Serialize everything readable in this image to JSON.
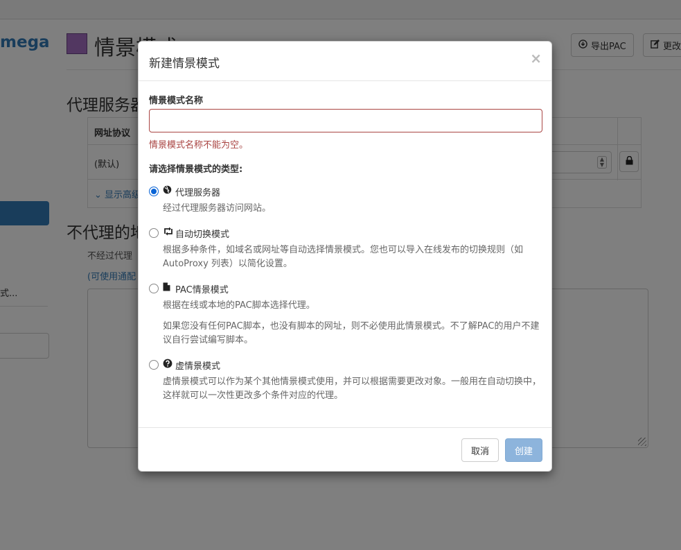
{
  "app": {
    "brand": "mega",
    "profile_title": "情景模式：",
    "export_pac_label": "导出PAC",
    "change_label": "更改"
  },
  "proxy_section": {
    "title": "代理服务器",
    "col_protocol": "网址协议",
    "default_row": "(默认)",
    "show_advanced": "显示高级"
  },
  "bypass_section": {
    "title": "不代理的地址",
    "description": "不经过代理",
    "wildcard_hint": "(可使用通配"
  },
  "sidebar": {
    "item_text": "式..."
  },
  "dialog": {
    "title": "新建情景模式",
    "close_symbol": "×",
    "name_label": "情景模式名称",
    "name_value": "",
    "name_placeholder": "",
    "name_error": "情景模式名称不能为空。",
    "type_label": "请选择情景模式的类型:",
    "options": [
      {
        "name": "代理服务器",
        "icon": "globe-icon",
        "checked": true,
        "desc": "经过代理服务器访问网站。"
      },
      {
        "name": "自动切换模式",
        "icon": "retweet-icon",
        "checked": false,
        "desc": "根据多种条件，如域名或网址等自动选择情景模式。您也可以导入在线发布的切换规则（如 AutoProxy 列表）以简化设置。"
      },
      {
        "name": "PAC情景模式",
        "icon": "file-icon",
        "checked": false,
        "desc": "根据在线或本地的PAC脚本选择代理。",
        "desc2": "如果您没有任何PAC脚本，也没有脚本的网址，则不必使用此情景模式。不了解PAC的用户不建议自行尝试编写脚本。"
      },
      {
        "name": "虚情景模式",
        "icon": "question-sign-icon",
        "checked": false,
        "desc": "虚情景模式可以作为某个其他情景模式使用，并可以根据需要更改对象。一般用在自动切换中，这样就可以一次性更改多个条件对应的代理。"
      }
    ],
    "cancel_label": "取消",
    "create_label": "创建"
  },
  "colors": {
    "profile_color": "#a46fc2",
    "accent": "#337ab7",
    "error": "#a94442",
    "create_disabled": "#8db4dc"
  }
}
